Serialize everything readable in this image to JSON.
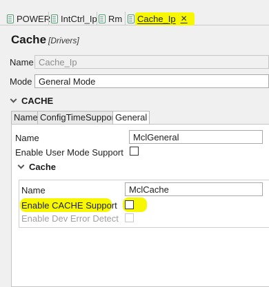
{
  "tabs": [
    {
      "label": "POWER",
      "active": false
    },
    {
      "label": "IntCtrl_Ip",
      "active": false
    },
    {
      "label": "Rm",
      "active": false
    },
    {
      "label": "Cache_Ip",
      "active": true,
      "closable": true
    }
  ],
  "close_glyph": "✕",
  "editor": {
    "title": "Cache",
    "subtitle": "[Drivers]",
    "name_label": "Name",
    "name_value": "Cache_Ip",
    "mode_label": "Mode",
    "mode_value": "General Mode",
    "section_title": "CACHE"
  },
  "subtabs": [
    {
      "label": "Name",
      "selected": false
    },
    {
      "label": "ConfigTimeSupport",
      "selected": false
    },
    {
      "label": "General",
      "selected": true
    }
  ],
  "general": {
    "name_label": "Name",
    "name_value": "MclGeneral",
    "user_mode_label": "Enable User Mode Support",
    "user_mode_checked": false
  },
  "cache_group": {
    "title": "Cache",
    "name_label": "Name",
    "name_value": "MclCache",
    "enable_cache_label": "Enable CACHE Support",
    "enable_cache_checked": false,
    "dev_error_label": "Enable Dev Error Detect",
    "dev_error_checked": false,
    "dev_error_enabled": false
  },
  "colors": {
    "highlight": "#f6f700",
    "tab_icon": "#4a9a6e"
  }
}
